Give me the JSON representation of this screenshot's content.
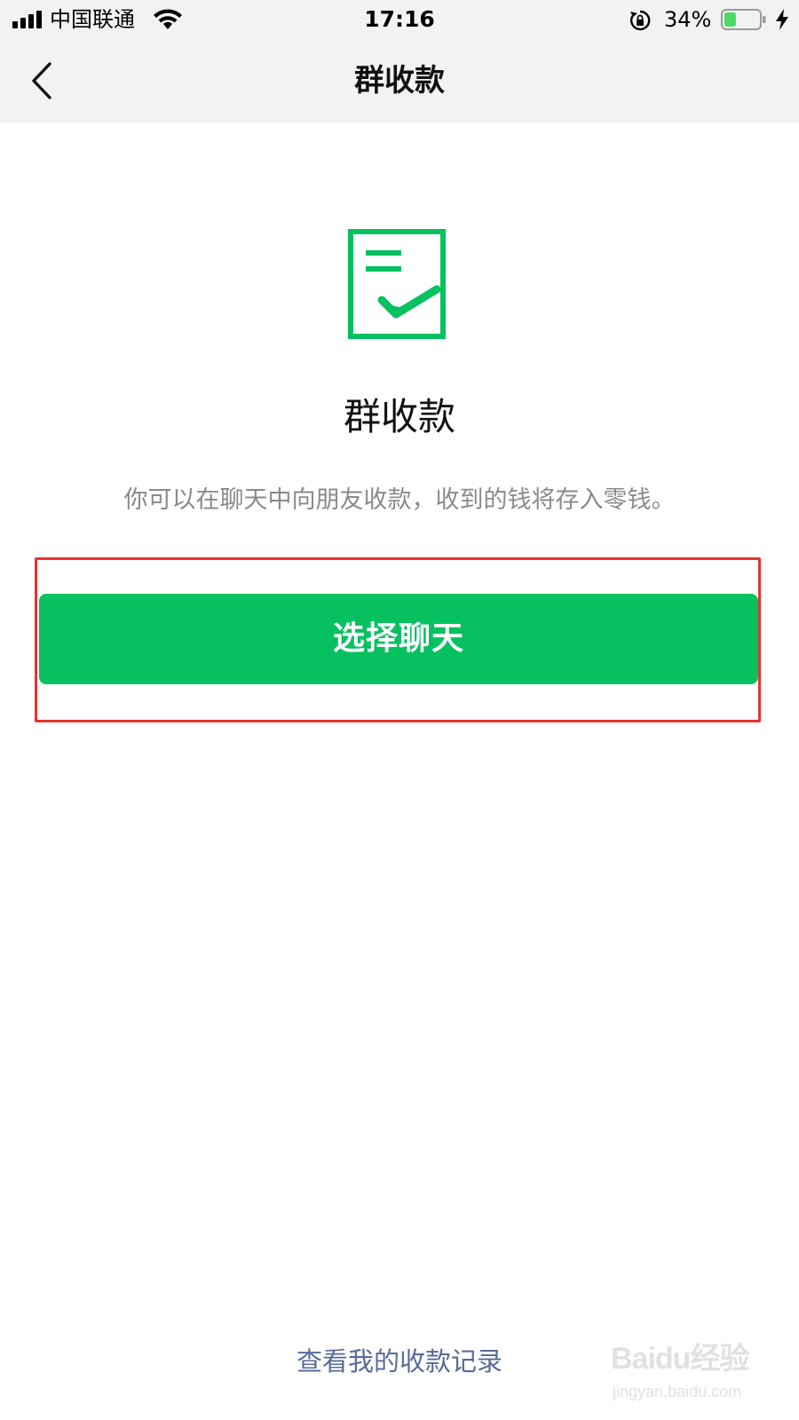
{
  "status_bar": {
    "carrier": "中国联通",
    "time": "17:16",
    "battery_percent": "34%",
    "battery_level": 0.34,
    "charging": true
  },
  "nav": {
    "title": "群收款"
  },
  "content": {
    "title": "群收款",
    "description": "你可以在聊天中向朋友收款，收到的钱将存入零钱。",
    "primary_button": "选择聊天",
    "records_link": "查看我的收款记录"
  },
  "watermark": {
    "logo": "Baidu经验",
    "url": "jingyan.baidu.com"
  },
  "colors": {
    "accent": "#07c160",
    "link": "#576b95",
    "highlight": "#e8322e",
    "nav_background": "#f2f2f2"
  }
}
